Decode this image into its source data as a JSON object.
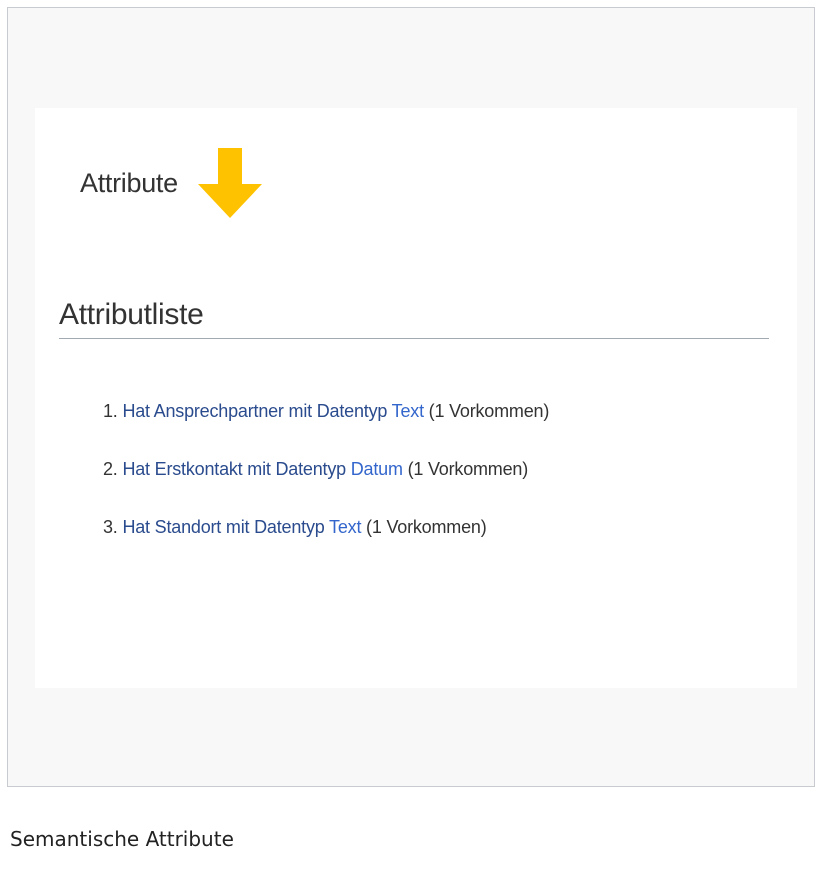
{
  "figure": {
    "header_title": "Attribute",
    "section_title": "Attributliste",
    "items": [
      {
        "number": "1.",
        "property": "Hat Ansprechpartner",
        "connector": " mit Datentyp ",
        "datatype": "Text",
        "count": " (1 Vorkommen)"
      },
      {
        "number": "2.",
        "property": "Hat Erstkontakt",
        "connector": " mit Datentyp ",
        "datatype": "Datum",
        "count": " (1 Vorkommen)"
      },
      {
        "number": "3.",
        "property": "Hat Standort",
        "connector": " mit Datentyp ",
        "datatype": "Text",
        "count": " (1 Vorkommen)"
      }
    ],
    "caption": "Semantische Attribute"
  },
  "icons": {
    "arrow": "arrow-down-icon"
  },
  "colors": {
    "arrow": "#ffc200",
    "link": "#3366cc",
    "link_dark": "#2a4b8d",
    "text": "#333333"
  }
}
